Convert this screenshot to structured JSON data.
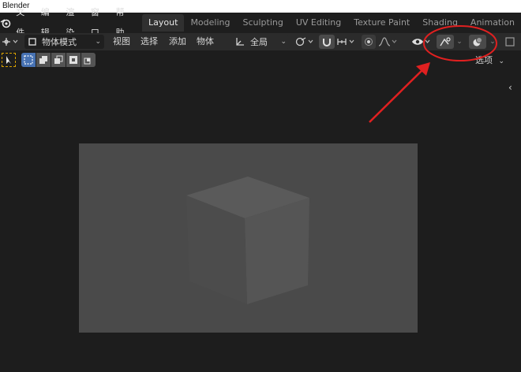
{
  "window": {
    "title": "Blender"
  },
  "menu": {
    "items": [
      "文件",
      "编辑",
      "渲染",
      "窗口",
      "帮助"
    ]
  },
  "workspaces": {
    "tabs": [
      {
        "label": "Layout",
        "active": true
      },
      {
        "label": "Modeling",
        "active": false
      },
      {
        "label": "Sculpting",
        "active": false
      },
      {
        "label": "UV Editing",
        "active": false
      },
      {
        "label": "Texture Paint",
        "active": false
      },
      {
        "label": "Shading",
        "active": false
      },
      {
        "label": "Animation",
        "active": false
      }
    ]
  },
  "header": {
    "mode": "物体模式",
    "view": "视图",
    "select": "选择",
    "add": "添加",
    "object": "物体",
    "transform_orientation": "全局"
  },
  "toolrow": {
    "options_label": "选项"
  },
  "annotation": {
    "color": "#e02020"
  },
  "colors": {
    "active_tab": "#303030",
    "header_bg": "#2b2b2b",
    "viewport_bg": "#1d1d1d",
    "camera_frame": "#4a4a4a",
    "accent_blue": "#4772b3"
  }
}
